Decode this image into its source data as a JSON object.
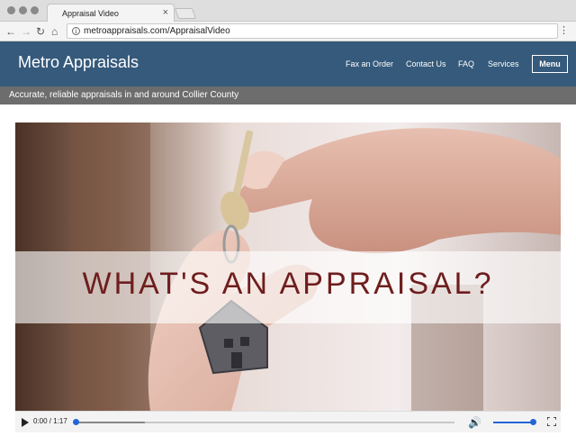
{
  "browser": {
    "tab_title": "Appraisal Video",
    "tab_close": "×",
    "url": "metroappraisals.com/AppraisalVideo",
    "nav": {
      "back": "←",
      "forward": "→",
      "reload": "↻",
      "home": "⌂",
      "info": "i",
      "more": "⋮"
    }
  },
  "header": {
    "brand": "Metro Appraisals",
    "nav_items": [
      {
        "label": "Fax an Order"
      },
      {
        "label": "Contact Us"
      },
      {
        "label": "FAQ"
      },
      {
        "label": "Services"
      }
    ],
    "menu_label": "Menu"
  },
  "tagline": "Accurate, reliable appraisals in and around Collier County",
  "video": {
    "title_overlay": "WHAT'S AN APPRAISAL?",
    "time": "0:00 / 1:17",
    "progress_fraction": 0,
    "buffered_fraction": 0.18,
    "volume_fraction": 0.95,
    "volume_icon": "🔊"
  },
  "colors": {
    "header_bg": "#355a7b",
    "tagline_bg": "#6d6d6d",
    "accent": "#2466d6",
    "overlay_text": "#6e1d1d"
  }
}
